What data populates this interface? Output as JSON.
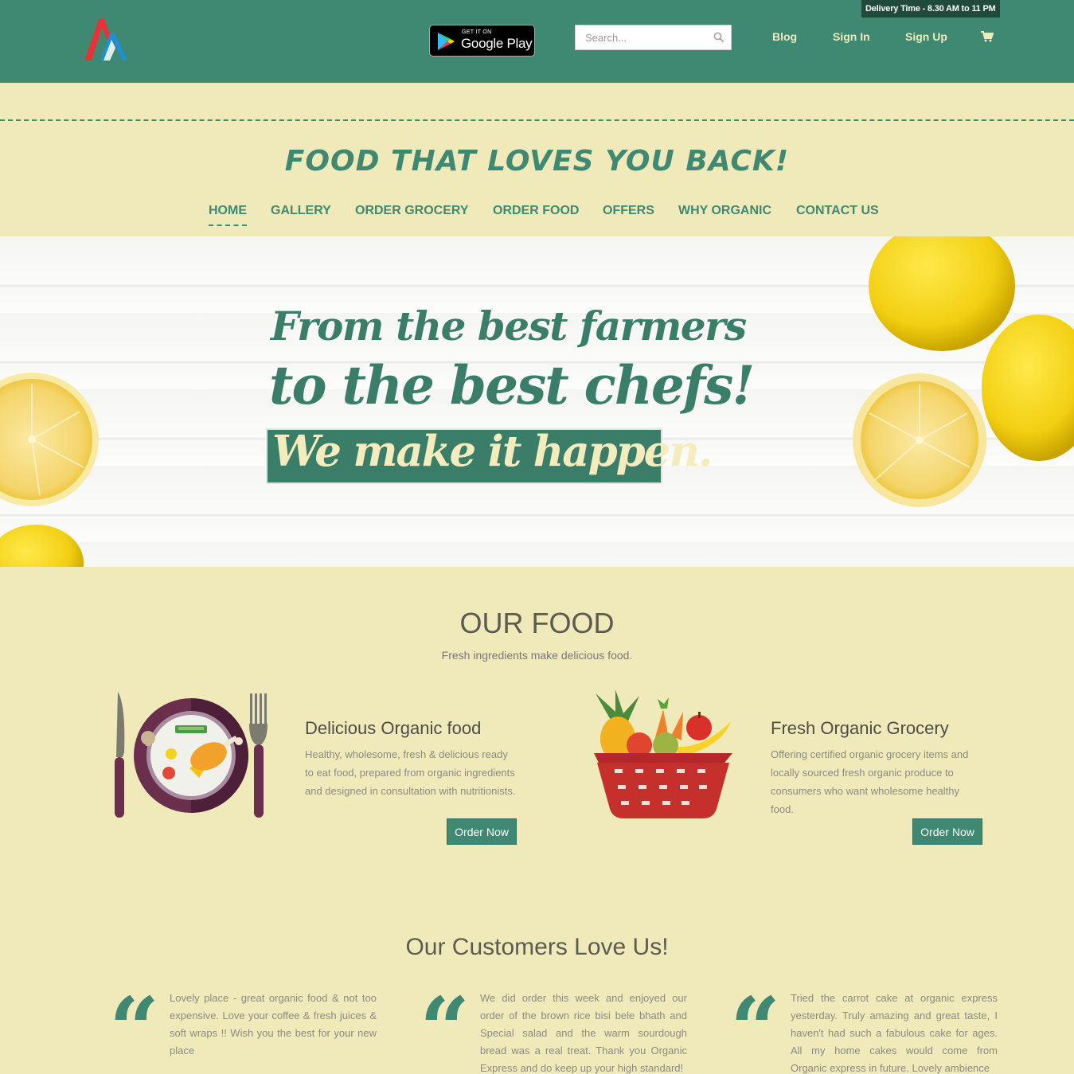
{
  "header": {
    "delivery_time": "Delivery Time - 8.30 AM to 11 PM",
    "google_play_small": "GET IT ON",
    "google_play_big": "Google Play",
    "search_placeholder": "Search...",
    "links": [
      "Blog",
      "Sign In",
      "Sign Up"
    ],
    "cart_icon": "shopping-cart-icon",
    "search_icon": "magnifier-icon"
  },
  "tagline": "FOOD THAT LOVES YOU BACK!",
  "nav": [
    "HOME",
    "GALLERY",
    "ORDER GROCERY",
    "ORDER FOOD",
    "OFFERS",
    "WHY ORGANIC",
    "CONTACT US"
  ],
  "hero": {
    "line1": "From the best farmers",
    "line2": "to the best chefs!",
    "line3": "We make it happen."
  },
  "our_food": {
    "title": "OUR FOOD",
    "subtitle": "Fresh ingredients make delicious food.",
    "cards": [
      {
        "title": "Delicious Organic food",
        "text": "Healthy, wholesome, fresh & delicious ready to eat food, prepared from organic ingredients and designed in consultation with nutritionists.",
        "button": "Order Now",
        "icon": "plate-cutlery-icon"
      },
      {
        "title": "Fresh Organic Grocery",
        "text": "Offering certified organic grocery items and locally sourced fresh organic produce to consumers who want wholesome healthy food.",
        "button": "Order Now",
        "icon": "fruit-basket-icon"
      }
    ]
  },
  "customers": {
    "title": "Our Customers Love Us!",
    "quote_mark": "“",
    "reviews": [
      "Lovely place - great organic food & not too expensive. Love your coffee & fresh juices & soft wraps !! Wish you the best for your new place",
      "We did order this week and enjoyed our order of the brown rice bisi bele bhath and Special salad and the warm sourdough bread was a real treat. Thank you Organic Express and do keep up your high standard!",
      "Tried the carrot cake at organic express yesterday. Truly amazing and great taste, I haven't had such a fabulous cake for ages. All my home cakes would come from Organic express in future. Lovely ambience"
    ]
  },
  "colors": {
    "primary": "#3f8872",
    "background": "#f0eabb",
    "dark": "#1f4a3c"
  }
}
